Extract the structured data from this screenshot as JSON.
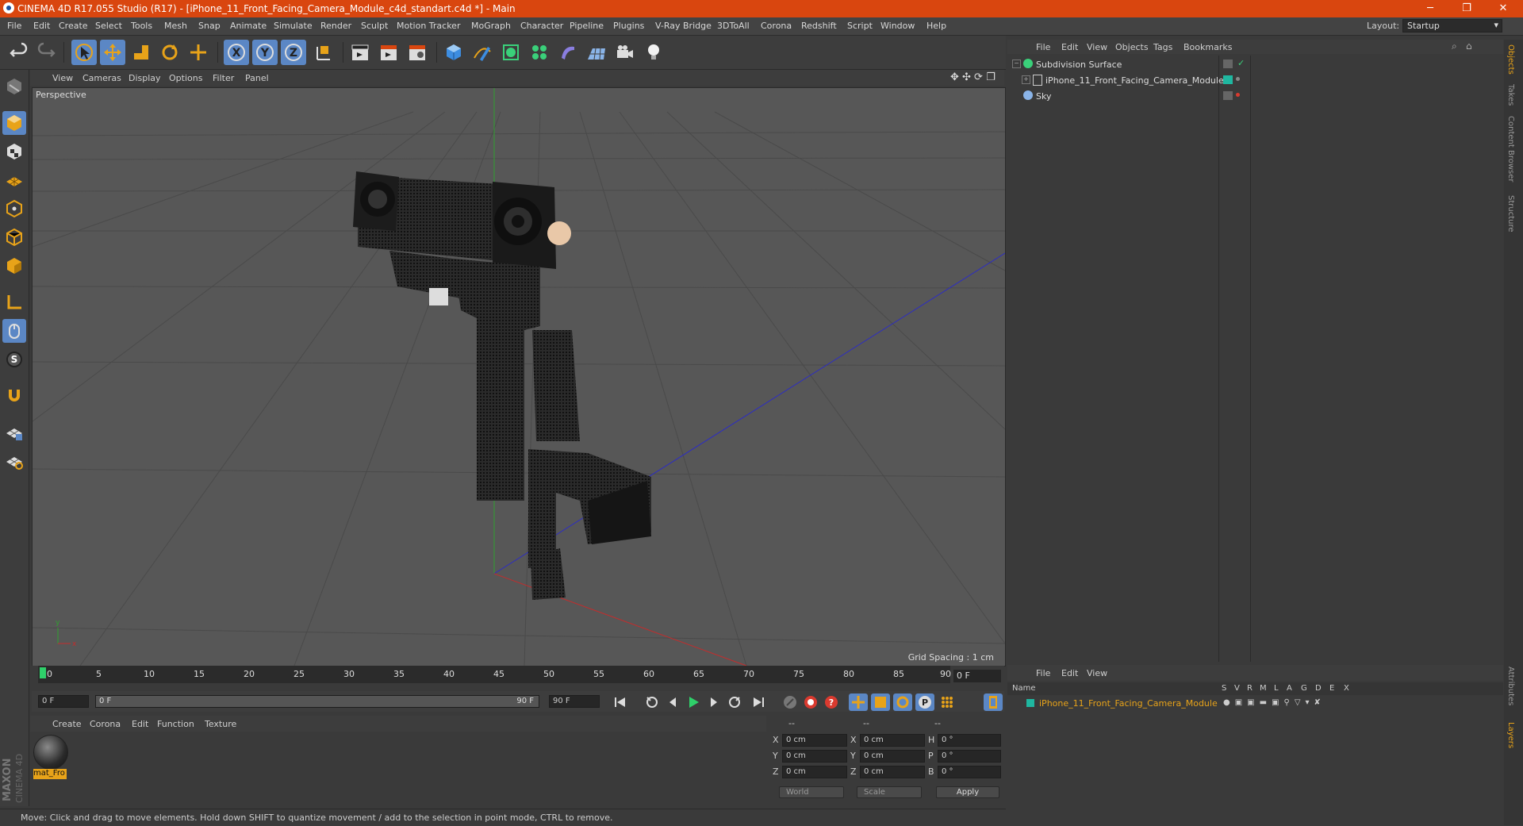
{
  "window": {
    "title": "CINEMA 4D R17.055 Studio (R17) - [iPhone_11_Front_Facing_Camera_Module_c4d_standart.c4d *] - Main",
    "minimize": "─",
    "maximize": "❐",
    "close": "✕"
  },
  "menu": {
    "items": [
      "File",
      "Edit",
      "Create",
      "Select",
      "Tools",
      "Mesh",
      "Snap",
      "Animate",
      "Simulate",
      "Render",
      "Sculpt",
      "Motion Tracker",
      "MoGraph",
      "Character",
      "Pipeline",
      "Plugins",
      "V-Ray Bridge",
      "3DToAll",
      "Corona",
      "Redshift",
      "Script",
      "Window",
      "Help"
    ],
    "layout_label": "Layout:",
    "layout_value": "Startup"
  },
  "toolbar": {
    "axis_x": "X",
    "axis_y": "Y",
    "axis_z": "Z"
  },
  "viewport": {
    "menu": [
      "View",
      "Cameras",
      "Display",
      "Options",
      "Filter",
      "Panel"
    ],
    "label": "Perspective",
    "grid_spacing": "Grid Spacing : 1 cm"
  },
  "timeline": {
    "ticks": [
      "0",
      "5",
      "10",
      "15",
      "20",
      "25",
      "30",
      "35",
      "40",
      "45",
      "50",
      "55",
      "60",
      "65",
      "70",
      "75",
      "80",
      "85",
      "90"
    ],
    "current_frame": "0 F",
    "start_frame": "0 F",
    "range_start": "0 F",
    "range_end": "90 F",
    "end_frame": "90 F"
  },
  "material_manager": {
    "menu": [
      "Create",
      "Corona",
      "Edit",
      "Function",
      "Texture"
    ],
    "material_name": "mat_Fro"
  },
  "coordinates": {
    "headers": [
      "--",
      "--",
      "--"
    ],
    "rows": [
      {
        "l1": "X",
        "v1": "0 cm",
        "l2": "X",
        "v2": "0 cm",
        "l3": "H",
        "v3": "0 °"
      },
      {
        "l1": "Y",
        "v1": "0 cm",
        "l2": "Y",
        "v2": "0 cm",
        "l3": "P",
        "v3": "0 °"
      },
      {
        "l1": "Z",
        "v1": "0 cm",
        "l2": "Z",
        "v2": "0 cm",
        "l3": "B",
        "v3": "0 °"
      }
    ],
    "space": "World",
    "mode": "Scale",
    "apply": "Apply"
  },
  "status": {
    "text": "Move: Click and drag to move elements. Hold down SHIFT to quantize movement / add to the selection in point mode, CTRL to remove."
  },
  "object_manager": {
    "menu": [
      "File",
      "Edit",
      "View",
      "Objects",
      "Tags",
      "Bookmarks"
    ],
    "objects": [
      {
        "name": "Subdivision Surface"
      },
      {
        "name": "iPhone_11_Front_Facing_Camera_Module"
      },
      {
        "name": "Sky"
      }
    ]
  },
  "layer_manager": {
    "menu": [
      "File",
      "Edit",
      "View"
    ],
    "columns": [
      "Name",
      "S",
      "V",
      "R",
      "M",
      "L",
      "A",
      "G",
      "D",
      "E",
      "X"
    ],
    "layer_name": "iPhone_11_Front_Facing_Camera_Module"
  },
  "side_tabs": [
    "Objects",
    "Takes",
    "Content Browser",
    "Structure",
    "Attributes",
    "Layers"
  ],
  "brand": {
    "maxon": "MAXON",
    "cinema": "CINEMA 4D"
  },
  "colors": {
    "titlebar": "#d9460f",
    "selection": "#5b87c5",
    "accent": "#e8a319",
    "layer_color": "#1fb7a0"
  }
}
